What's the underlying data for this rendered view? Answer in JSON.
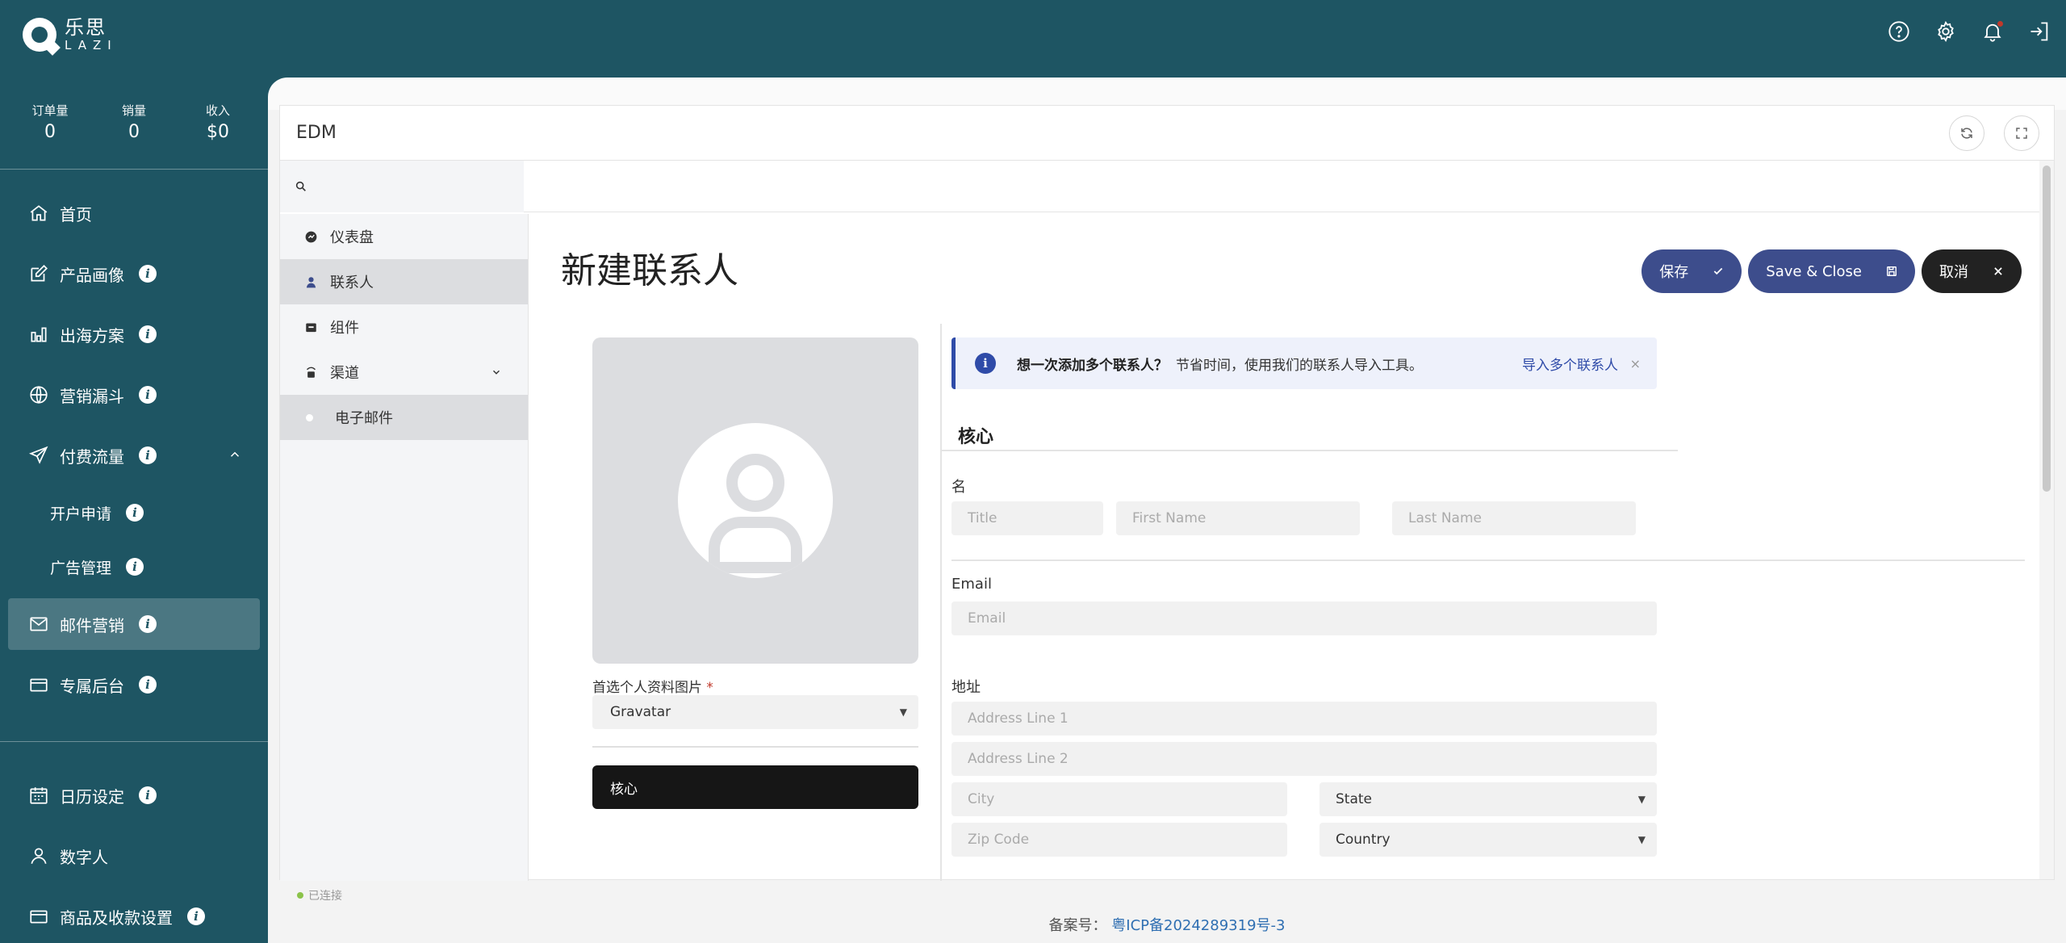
{
  "brand": {
    "name_cn": "乐思",
    "name_en": "LAZI"
  },
  "stats": [
    {
      "label": "订单量",
      "value": "0"
    },
    {
      "label": "销量",
      "value": "0"
    },
    {
      "label": "收入",
      "value": "$0"
    }
  ],
  "sidebar": {
    "items": [
      {
        "label": "首页",
        "icon": "home-icon"
      },
      {
        "label": "产品画像",
        "icon": "edit-icon"
      },
      {
        "label": "出海方案",
        "icon": "bar-chart-icon"
      },
      {
        "label": "营销漏斗",
        "icon": "globe-icon"
      },
      {
        "label": "付费流量",
        "icon": "send-icon"
      }
    ],
    "sub_items": [
      {
        "label": "开户申请"
      },
      {
        "label": "广告管理"
      }
    ],
    "items_after": [
      {
        "label": "邮件营销",
        "icon": "mail-icon",
        "active": true
      },
      {
        "label": "专属后台",
        "icon": "card-icon"
      }
    ],
    "bottom_items": [
      {
        "label": "日历设定",
        "icon": "calendar-icon"
      },
      {
        "label": "数字人",
        "icon": "user-icon"
      },
      {
        "label": "商品及收款设置",
        "icon": "card-icon"
      }
    ]
  },
  "card": {
    "title": "EDM"
  },
  "search": {
    "placeholder": ""
  },
  "app_nav": {
    "items": [
      {
        "label": "仪表盘",
        "icon": "dashboard-icon"
      },
      {
        "label": "联系人",
        "icon": "contact-icon",
        "active": true
      },
      {
        "label": "组件",
        "icon": "component-icon"
      },
      {
        "label": "渠道",
        "icon": "channel-icon"
      }
    ],
    "sub_items": [
      {
        "label": "电子邮件"
      }
    ]
  },
  "page": {
    "title": "新建联系人",
    "buttons": {
      "save": "保存",
      "save_close": "Save & Close",
      "cancel": "取消"
    }
  },
  "avatar": {
    "label": "首选个人资料图片",
    "required_mark": "*",
    "select_value": "Gravatar",
    "core_tab": "核心"
  },
  "alert": {
    "bold": "想一次添加多个联系人？",
    "text": "节省时间，使用我们的联系人导入工具。",
    "link": "导入多个联系人",
    "close": "×"
  },
  "form": {
    "section": "核心",
    "name_label": "名",
    "title_ph": "Title",
    "first_ph": "First Name",
    "last_ph": "Last Name",
    "email_label": "Email",
    "email_ph": "Email",
    "address_label": "地址",
    "addr1_ph": "Address Line 1",
    "addr2_ph": "Address Line 2",
    "city_ph": "City",
    "state_value": "State",
    "zip_ph": "Zip Code",
    "country_value": "Country"
  },
  "status": {
    "text": "已连接"
  },
  "footer": {
    "prefix": "备案号：",
    "icp": "粤ICP备2024289319号-3"
  }
}
